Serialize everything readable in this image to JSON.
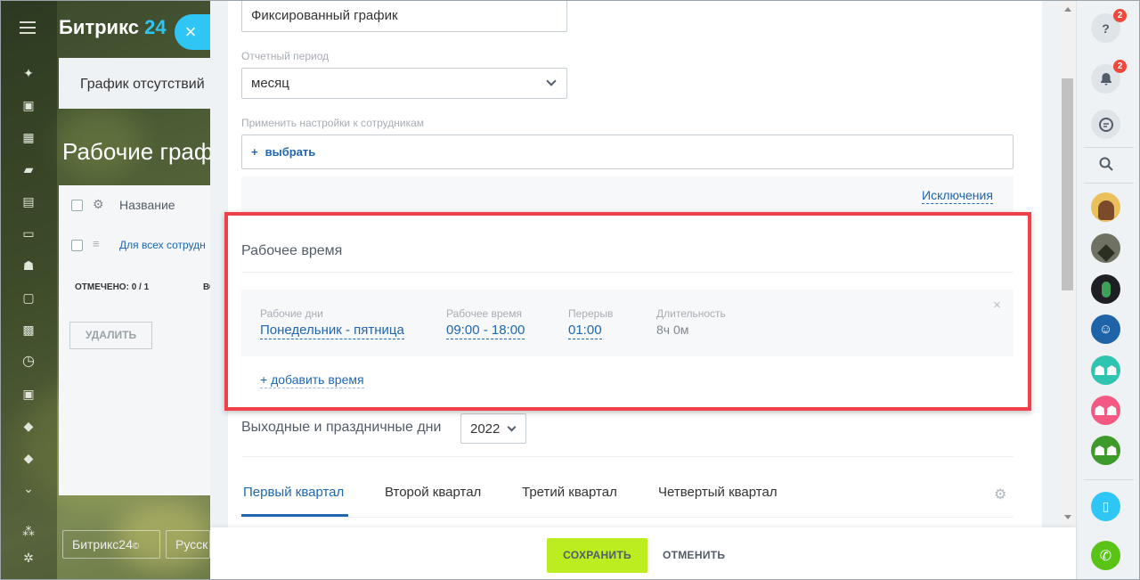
{
  "background": {
    "brand_name": "Битрикс",
    "brand_suffix": "24",
    "tab_label": "График отсутствий",
    "page_title": "Рабочие граф",
    "table_header_name": "Название",
    "table_row_link": "Для всех сотрудн",
    "selected_count": "ОТМЕЧЕНО: 0 / 1",
    "truncated_col": "ВС",
    "delete_button": "УДАЛИТЬ",
    "footer_brand": "Битрикс24",
    "footer_lang": "Русск"
  },
  "form": {
    "schedule_name_value": "Фиксированный график",
    "report_period_label": "Отчетный период",
    "report_period_value": "месяц",
    "apply_label": "Применить настройки к сотрудникам",
    "select_employees": "выбрать",
    "exceptions_link": "Исключения"
  },
  "work_time": {
    "section_title": "Рабочее время",
    "days_label": "Рабочие дни",
    "days_value": "Понедельник - пятница",
    "hours_label": "Рабочее время",
    "hours_value": "09:00 - 18:00",
    "break_label": "Перерыв",
    "break_value": "01:00",
    "duration_label": "Длительность",
    "duration_value": "8ч 0м",
    "add_time": "+ добавить время"
  },
  "holidays": {
    "section_title": "Выходные и праздничные дни",
    "year_value": "2022",
    "tabs": [
      "Первый квартал",
      "Второй квартал",
      "Третий квартал",
      "Четвертый квартал"
    ],
    "active_tab": 0
  },
  "footer": {
    "save_label": "СОХРАНИТЬ",
    "cancel_label": "ОТМЕНИТЬ"
  },
  "right_bar": {
    "help_badge": "2",
    "notifications_badge": "2"
  },
  "colors": {
    "accent_blue": "#2067b0",
    "highlight_red": "#f0404a",
    "save_green": "#bbed21",
    "brand_cyan": "#2fc6f6"
  }
}
